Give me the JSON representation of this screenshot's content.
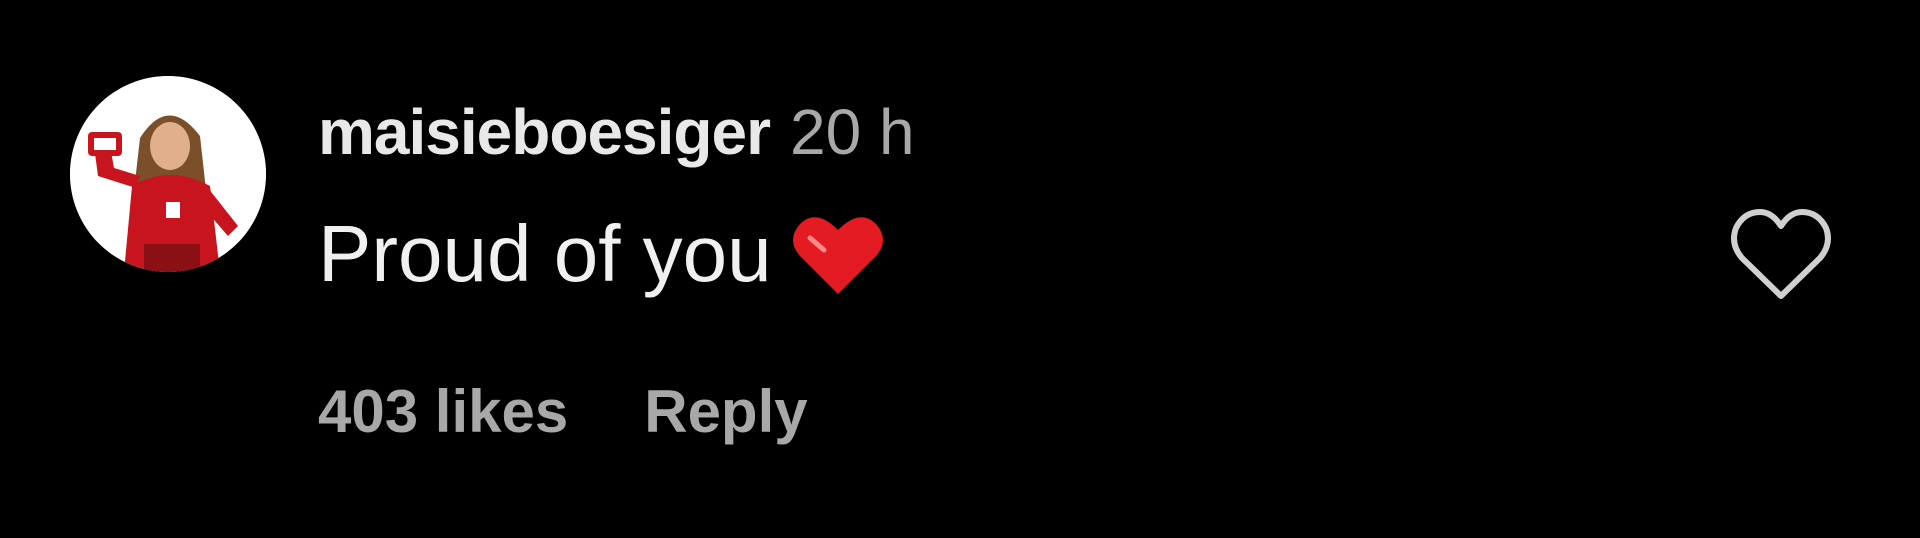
{
  "comment": {
    "username": "maisieboesiger",
    "timestamp": "20 h",
    "text": "Proud of you",
    "emoji": "red-heart",
    "likes": "403 likes",
    "reply_label": "Reply",
    "like_icon": "heart-outline-icon"
  },
  "colors": {
    "background": "#000000",
    "username": "#e8e8e8",
    "text": "#f0f0f0",
    "secondary": "#a8a8a8",
    "heart_emoji": "#e41b23"
  }
}
